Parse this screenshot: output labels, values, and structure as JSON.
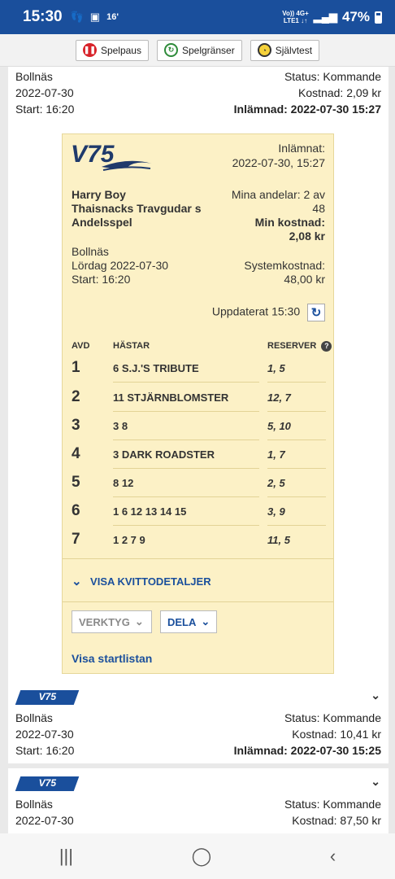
{
  "status_bar": {
    "time": "15:30",
    "net_top": "Vo)) 4G+",
    "net_bottom": "LTE1 ↓↑",
    "battery": "47%",
    "notif_temp": "16'"
  },
  "rg_bar": {
    "pause": "Spelpaus",
    "limits": "Spelgränser",
    "selftest": "Självtest"
  },
  "card1": {
    "track": "Bollnäs",
    "date": "2022-07-30",
    "start": "Start: 16:20",
    "status": "Status: Kommande",
    "cost": "Kostnad: 2,09 kr",
    "submitted": "Inlämnad: 2022-07-30 15:27"
  },
  "ticket": {
    "logo": "V75",
    "submitted_label": "Inlämnat:",
    "submitted_value": "2022-07-30, 15:27",
    "owner": "Harry Boy",
    "team": "Thaisnacks Travgudar s",
    "type": "Andelsspel",
    "shares_label": "Mina andelar: 2 av",
    "shares_value": "48",
    "min_cost_label": "Min kostnad:",
    "min_cost_value": "2,08 kr",
    "track": "Bollnäs",
    "day": "Lördag 2022-07-30",
    "start": "Start: 16:20",
    "system_cost_label": "Systemkostnad:",
    "system_cost_value": "48,00 kr",
    "updated": "Uppdaterat 15:30",
    "col_avd": "AVD",
    "col_hastar": "HÄSTAR",
    "col_reserver": "RESERVER",
    "rows": [
      {
        "avd": "1",
        "horses": "6  S.J.'S TRIBUTE",
        "reserves": "1, 5"
      },
      {
        "avd": "2",
        "horses": "11  STJÄRNBLOMSTER",
        "reserves": "12, 7"
      },
      {
        "avd": "3",
        "horses": "3 8",
        "reserves": "5, 10"
      },
      {
        "avd": "4",
        "horses": "3  DARK ROADSTER",
        "reserves": "1, 7"
      },
      {
        "avd": "5",
        "horses": "8 12",
        "reserves": "2, 5"
      },
      {
        "avd": "6",
        "horses": "1  6  12  13  14  15",
        "reserves": "3, 9"
      },
      {
        "avd": "7",
        "horses": "1 2 7 9",
        "reserves": "11, 5"
      }
    ],
    "details_link": "VISA KVITTODETALJER",
    "tools": "VERKTYG",
    "share": "DELA",
    "startlist": "Visa startlistan"
  },
  "card2": {
    "tag": "V75",
    "track": "Bollnäs",
    "date": "2022-07-30",
    "start": "Start: 16:20",
    "status": "Status: Kommande",
    "cost": "Kostnad: 10,41 kr",
    "submitted": "Inlämnad: 2022-07-30 15:25"
  },
  "card3": {
    "tag": "V75",
    "track": "Bollnäs",
    "date": "2022-07-30",
    "status": "Status: Kommande",
    "cost": "Kostnad: 87,50 kr"
  },
  "colors": {
    "brand": "#1a4f9c",
    "ticket_bg": "#fcf1c6",
    "pause_red": "#d8232a"
  }
}
